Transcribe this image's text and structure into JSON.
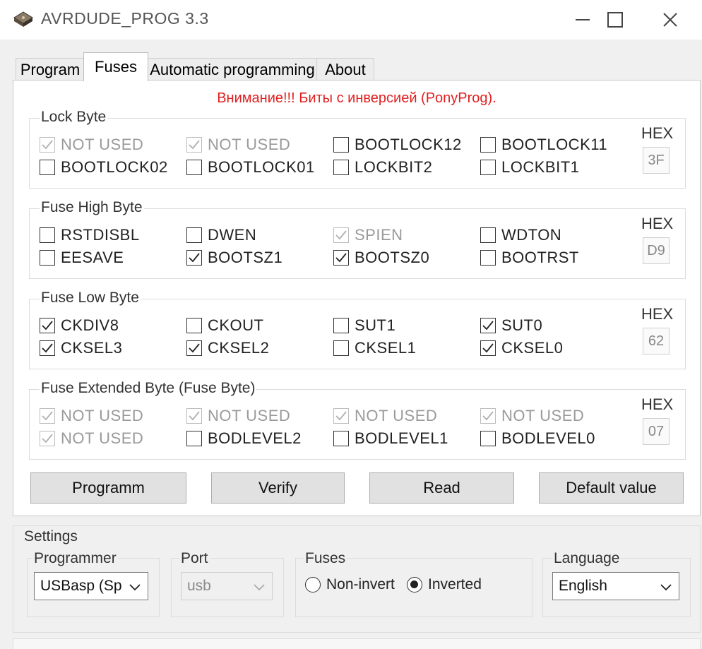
{
  "window": {
    "title": "AVRDUDE_PROG 3.3"
  },
  "tabs": [
    "Program",
    "Fuses",
    "Automatic programming",
    "About"
  ],
  "warning": "Внимание!!! Биты с инверсией (PonyProg).",
  "hex_label": "HEX",
  "groups": [
    {
      "title": "Lock Byte",
      "hex": "3F",
      "rows": [
        [
          {
            "label": "NOT USED",
            "checked": true,
            "disabled": true
          },
          {
            "label": "NOT USED",
            "checked": true,
            "disabled": true
          },
          {
            "label": "BOOTLOCK12",
            "checked": false,
            "disabled": false
          },
          {
            "label": "BOOTLOCK11",
            "checked": false,
            "disabled": false
          }
        ],
        [
          {
            "label": "BOOTLOCK02",
            "checked": false,
            "disabled": false
          },
          {
            "label": "BOOTLOCK01",
            "checked": false,
            "disabled": false
          },
          {
            "label": "LOCKBIT2",
            "checked": false,
            "disabled": false
          },
          {
            "label": "LOCKBIT1",
            "checked": false,
            "disabled": false
          }
        ]
      ]
    },
    {
      "title": "Fuse High Byte",
      "hex": "D9",
      "rows": [
        [
          {
            "label": "RSTDISBL",
            "checked": false,
            "disabled": false
          },
          {
            "label": "DWEN",
            "checked": false,
            "disabled": false
          },
          {
            "label": "SPIEN",
            "checked": true,
            "disabled": true
          },
          {
            "label": "WDTON",
            "checked": false,
            "disabled": false
          }
        ],
        [
          {
            "label": "EESAVE",
            "checked": false,
            "disabled": false
          },
          {
            "label": "BOOTSZ1",
            "checked": true,
            "disabled": false
          },
          {
            "label": "BOOTSZ0",
            "checked": true,
            "disabled": false
          },
          {
            "label": "BOOTRST",
            "checked": false,
            "disabled": false
          }
        ]
      ]
    },
    {
      "title": "Fuse Low Byte",
      "hex": "62",
      "rows": [
        [
          {
            "label": "CKDIV8",
            "checked": true,
            "disabled": false
          },
          {
            "label": "CKOUT",
            "checked": false,
            "disabled": false
          },
          {
            "label": "SUT1",
            "checked": false,
            "disabled": false
          },
          {
            "label": "SUT0",
            "checked": true,
            "disabled": false
          }
        ],
        [
          {
            "label": "CKSEL3",
            "checked": true,
            "disabled": false
          },
          {
            "label": "CKSEL2",
            "checked": true,
            "disabled": false
          },
          {
            "label": "CKSEL1",
            "checked": false,
            "disabled": false
          },
          {
            "label": "CKSEL0",
            "checked": true,
            "disabled": false
          }
        ]
      ]
    },
    {
      "title": "Fuse Extended Byte (Fuse Byte)",
      "hex": "07",
      "rows": [
        [
          {
            "label": "NOT USED",
            "checked": true,
            "disabled": true
          },
          {
            "label": "NOT USED",
            "checked": true,
            "disabled": true
          },
          {
            "label": "NOT USED",
            "checked": true,
            "disabled": true
          },
          {
            "label": "NOT USED",
            "checked": true,
            "disabled": true
          }
        ],
        [
          {
            "label": "NOT USED",
            "checked": true,
            "disabled": true
          },
          {
            "label": "BODLEVEL2",
            "checked": false,
            "disabled": false
          },
          {
            "label": "BODLEVEL1",
            "checked": false,
            "disabled": false
          },
          {
            "label": "BODLEVEL0",
            "checked": false,
            "disabled": false
          }
        ]
      ]
    }
  ],
  "buttons": {
    "programm": "Programm",
    "verify": "Verify",
    "read": "Read",
    "default": "Default value"
  },
  "settings": {
    "title": "Settings",
    "programmer": {
      "label": "Programmer",
      "value": "USBasp (Sp"
    },
    "port": {
      "label": "Port",
      "value": "usb"
    },
    "fuses": {
      "label": "Fuses",
      "option_noninvert": "Non-invert",
      "option_inverted": "Inverted",
      "selected": "Inverted"
    },
    "language": {
      "label": "Language",
      "value": "English"
    }
  },
  "icons": {
    "app": "chip-icon",
    "minimize": "minimize-icon",
    "maximize": "maximize-icon",
    "close": "close-icon",
    "dropdown": "chevron-down-icon"
  },
  "colors": {
    "warning": "#e02020",
    "disabled_text": "#9a9a9a"
  }
}
